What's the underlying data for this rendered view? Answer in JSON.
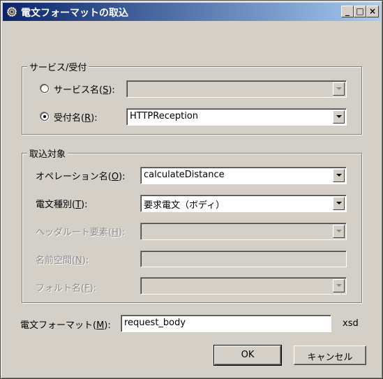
{
  "window": {
    "title": "電文フォーマットの取込",
    "buttons": {
      "minimize": "_",
      "maximize": "□",
      "close": "×"
    }
  },
  "service_group": {
    "title": "サービス/受付",
    "service_name": {
      "label": "サービス名(",
      "mnemonic": "S",
      "suffix": "):",
      "value": "",
      "selected": false
    },
    "reception_name": {
      "label": "受付名(",
      "mnemonic": "R",
      "suffix": "):",
      "value": "HTTPReception",
      "selected": true
    }
  },
  "target_group": {
    "title": "取込対象",
    "operation": {
      "label": "オペレーション名(",
      "mnemonic": "O",
      "suffix": "):",
      "value": "calculateDistance"
    },
    "message_type": {
      "label": "電文種別(",
      "mnemonic": "T",
      "suffix": "):",
      "value": "要求電文（ボディ）"
    },
    "header_root": {
      "label": "ヘッダルート要素(",
      "mnemonic": "H",
      "suffix": "):",
      "value": ""
    },
    "namespace": {
      "label": "名前空間(",
      "mnemonic": "N",
      "suffix": "):",
      "value": ""
    },
    "fault_name": {
      "label": "フォルト名(",
      "mnemonic": "F",
      "suffix": "):",
      "value": ""
    }
  },
  "format": {
    "label": "電文フォーマット(",
    "mnemonic": "M",
    "suffix": "):",
    "value": "request_body",
    "extension": "xsd"
  },
  "actions": {
    "ok": "OK",
    "cancel": "キャンセル"
  }
}
